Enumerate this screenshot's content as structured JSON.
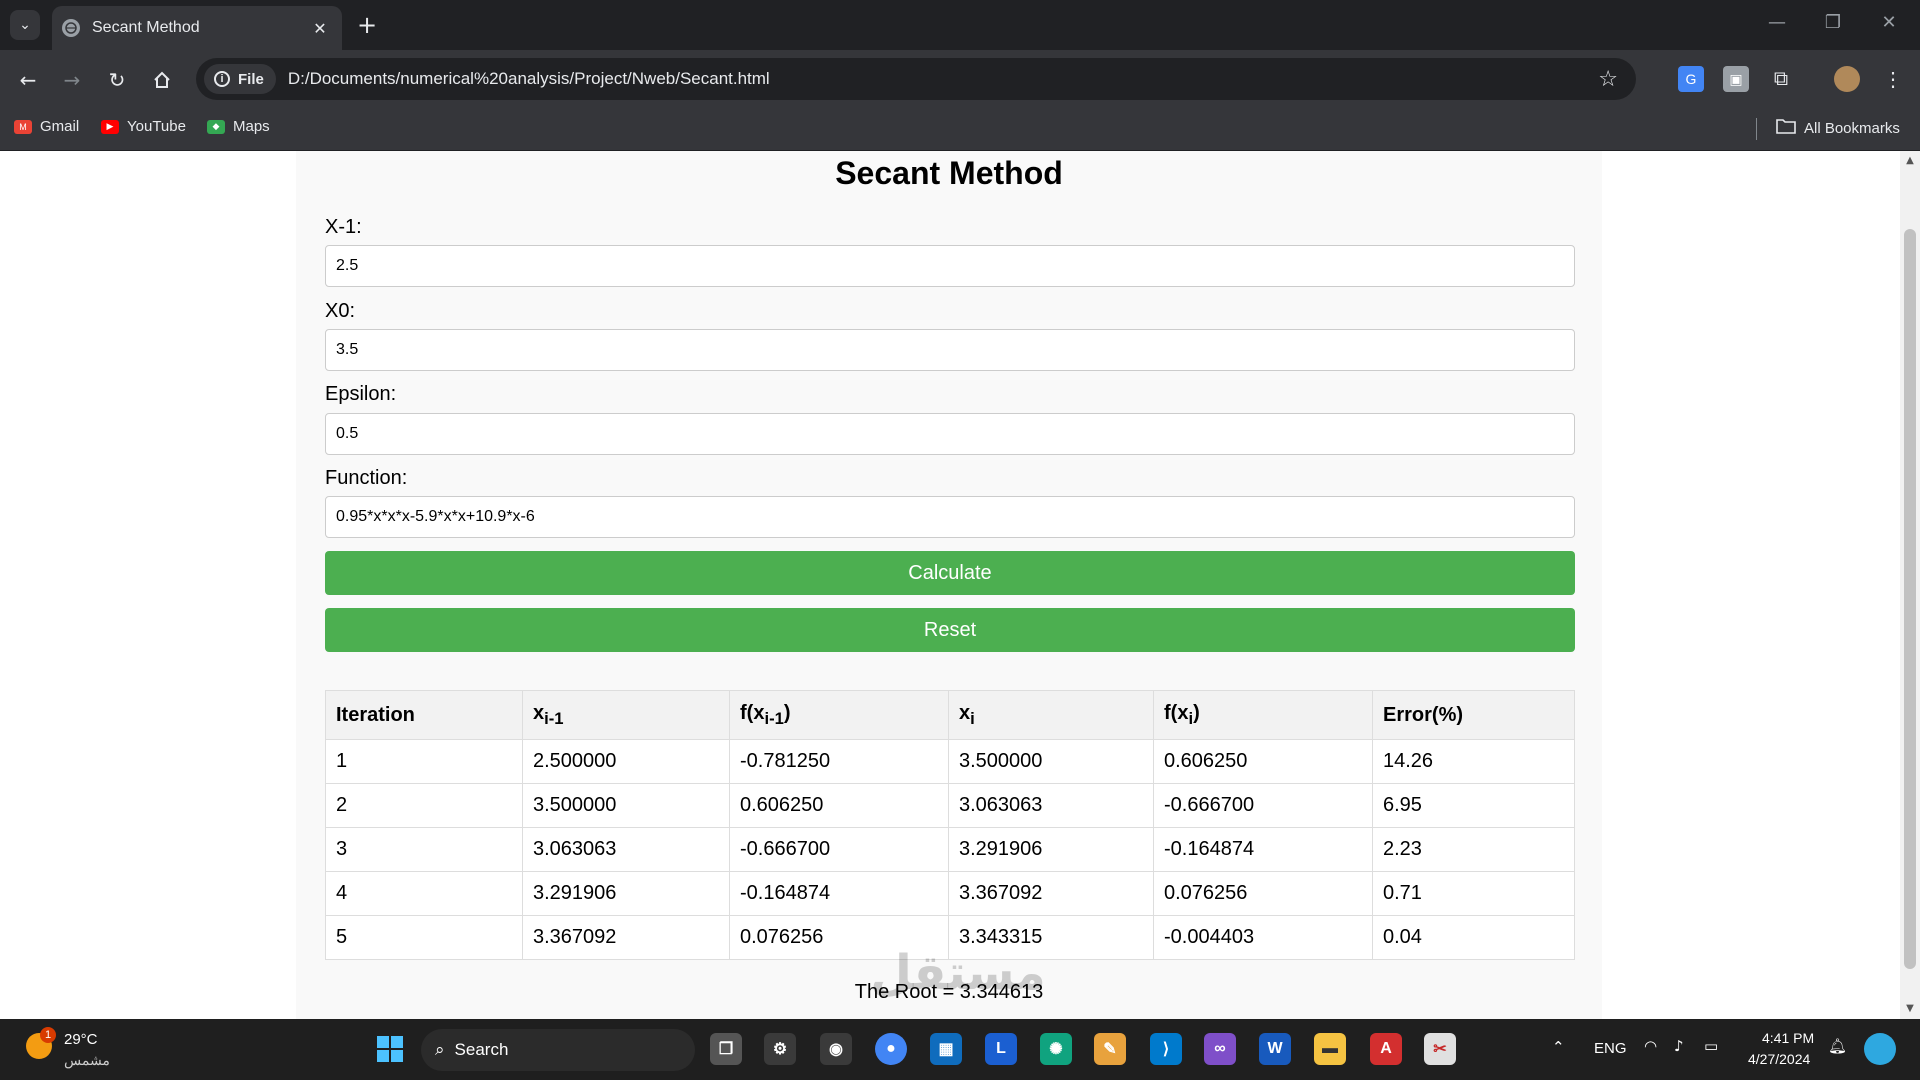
{
  "browser": {
    "tab_title": "Secant Method",
    "tab_close": "✕",
    "new_tab": "+",
    "omnibox_chip": "File",
    "url": "D:/Documents/numerical%20analysis/Project/Nweb/Secant.html",
    "bookmarks": [
      "Gmail",
      "YouTube",
      "Maps"
    ],
    "all_bookmarks": "All Bookmarks"
  },
  "page": {
    "title": "Secant Method",
    "fields": [
      {
        "label": "X-1:",
        "value": "2.5"
      },
      {
        "label": "X0:",
        "value": "3.5"
      },
      {
        "label": "Epsilon:",
        "value": "0.5"
      },
      {
        "label": "Function:",
        "value": "0.95*x*x*x-5.9*x*x+10.9*x-6"
      }
    ],
    "calculate_label": "Calculate",
    "reset_label": "Reset",
    "table": {
      "headers": [
        "Iteration",
        "x",
        "f(x",
        "x",
        "f(x",
        "Error(%)"
      ],
      "header_subscripts": [
        "",
        "i-1",
        "i-1",
        "i",
        "i",
        ""
      ],
      "rows": [
        [
          "1",
          "2.500000",
          "-0.781250",
          "3.500000",
          "0.606250",
          "14.26"
        ],
        [
          "2",
          "3.500000",
          "0.606250",
          "3.063063",
          "-0.666700",
          "6.95"
        ],
        [
          "3",
          "3.063063",
          "-0.666700",
          "3.291906",
          "-0.164874",
          "2.23"
        ],
        [
          "4",
          "3.291906",
          "-0.164874",
          "3.367092",
          "0.076256",
          "0.71"
        ],
        [
          "5",
          "3.367092",
          "0.076256",
          "3.343315",
          "-0.004403",
          "0.04"
        ]
      ]
    },
    "root_text": "The Root = 3.344613"
  },
  "watermark": "مستقل",
  "taskbar": {
    "weather_temp": "29°C",
    "weather_desc": "مشمس",
    "weather_badge": "1",
    "search_label": "Search",
    "language": "ENG",
    "time": "4:41 PM",
    "date": "4/27/2024"
  },
  "colors": {
    "button_green": "#4caf50",
    "chrome_dark": "#202124",
    "chrome_toolbar": "#35363a"
  }
}
